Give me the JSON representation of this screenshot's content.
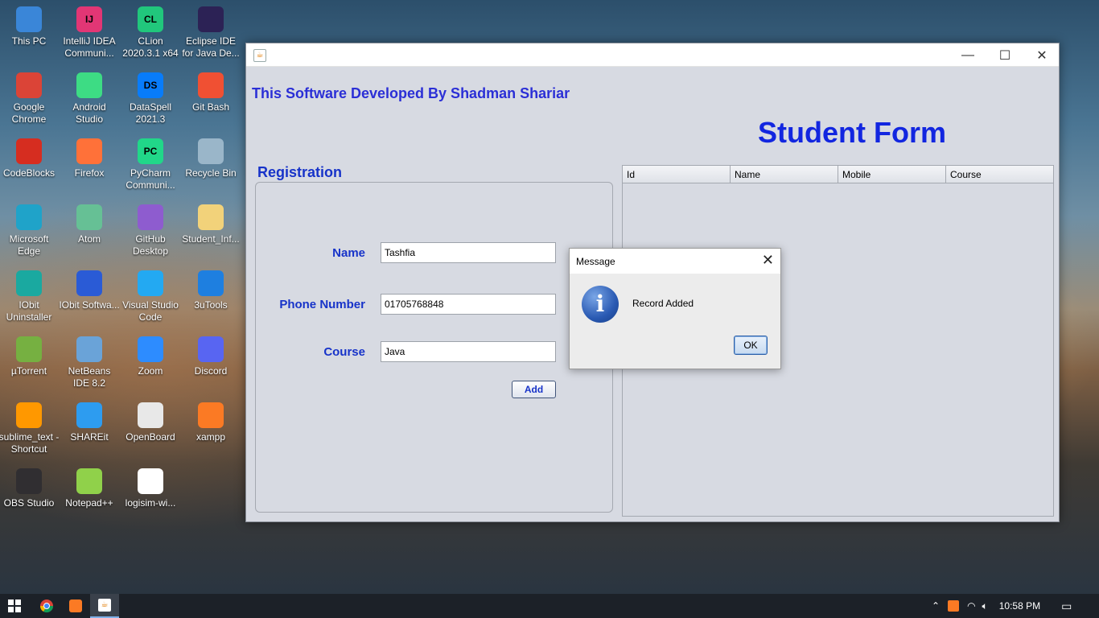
{
  "desktop": {
    "icons": [
      {
        "label": "This PC",
        "icon": "monitor-icon",
        "color": "#3a86d8"
      },
      {
        "label": "IntelliJ IDEA Communi...",
        "icon": "intellij-icon",
        "color": "#e23675",
        "glyph": "IJ"
      },
      {
        "label": "CLion 2020.3.1 x64",
        "icon": "clion-icon",
        "color": "#21c77c",
        "glyph": "CL"
      },
      {
        "label": "Eclipse IDE for Java De...",
        "icon": "eclipse-icon",
        "color": "#2c2255"
      },
      {
        "label": "Google Chrome",
        "icon": "chrome-icon",
        "color": "#db4437"
      },
      {
        "label": "Android Studio",
        "icon": "android-studio-icon",
        "color": "#3ddc84"
      },
      {
        "label": "DataSpell 2021.3",
        "icon": "dataspell-icon",
        "color": "#087cfa",
        "glyph": "DS"
      },
      {
        "label": "Git Bash",
        "icon": "git-bash-icon",
        "color": "#f05033"
      },
      {
        "label": "CodeBlocks",
        "icon": "codeblocks-icon",
        "color": "#d62d20"
      },
      {
        "label": "Firefox",
        "icon": "firefox-icon",
        "color": "#ff7139"
      },
      {
        "label": "PyCharm Communi...",
        "icon": "pycharm-icon",
        "color": "#21d789",
        "glyph": "PC"
      },
      {
        "label": "Recycle Bin",
        "icon": "recycle-bin-icon",
        "color": "#9ab6c9"
      },
      {
        "label": "Microsoft Edge",
        "icon": "edge-icon",
        "color": "#1fa3c9"
      },
      {
        "label": "Atom",
        "icon": "atom-icon",
        "color": "#66c095"
      },
      {
        "label": "GitHub Desktop",
        "icon": "github-desktop-icon",
        "color": "#8e5ccf"
      },
      {
        "label": "Student_Inf...",
        "icon": "folder-icon",
        "color": "#f2d27a"
      },
      {
        "label": "IObit Uninstaller",
        "icon": "iobit-uninstaller-icon",
        "color": "#1aa9a0"
      },
      {
        "label": "IObit Softwa...",
        "icon": "iobit-software-icon",
        "color": "#2a5bd6"
      },
      {
        "label": "Visual Studio Code",
        "icon": "vscode-icon",
        "color": "#23a9f2"
      },
      {
        "label": "3uTools",
        "icon": "3utools-icon",
        "color": "#1e7fe0"
      },
      {
        "label": "µTorrent",
        "icon": "utorrent-icon",
        "color": "#76b041"
      },
      {
        "label": "NetBeans IDE 8.2",
        "icon": "netbeans-icon",
        "color": "#6aa3d8"
      },
      {
        "label": "Zoom",
        "icon": "zoom-icon",
        "color": "#2d8cff"
      },
      {
        "label": "Discord",
        "icon": "discord-icon",
        "color": "#5865f2"
      },
      {
        "label": "sublime_text - Shortcut",
        "icon": "sublime-icon",
        "color": "#ff9800"
      },
      {
        "label": "SHAREit",
        "icon": "shareit-icon",
        "color": "#2d9cf0"
      },
      {
        "label": "OpenBoard",
        "icon": "openboard-icon",
        "color": "#e8e8e8"
      },
      {
        "label": "xampp",
        "icon": "xampp-icon",
        "color": "#fb7a24"
      },
      {
        "label": "OBS Studio",
        "icon": "obs-icon",
        "color": "#302e31"
      },
      {
        "label": "Notepad++",
        "icon": "notepadpp-icon",
        "color": "#90d14a"
      },
      {
        "label": "logisim-wi...",
        "icon": "logisim-icon",
        "color": "#ffffff"
      }
    ]
  },
  "window": {
    "developer_text": "This Software Developed By Shadman Shariar",
    "form_title": "Student Form",
    "registration_title": "Registration",
    "fields": {
      "name_label": "Name",
      "name_value": "Tashfia",
      "phone_label": "Phone Number",
      "phone_value": "01705768848",
      "course_label": "Course",
      "course_value": "Java"
    },
    "add_button": "Add",
    "table": {
      "columns": [
        "Id",
        "Name",
        "Mobile",
        "Course"
      ]
    },
    "controls": {
      "minimize": "—",
      "maximize": "☐",
      "close": "✕"
    }
  },
  "dialog": {
    "title": "Message",
    "message": "Record Added",
    "ok_label": "OK",
    "close": "✕"
  },
  "taskbar": {
    "time": "10:58 PM",
    "accent": "#7fb0e8"
  }
}
